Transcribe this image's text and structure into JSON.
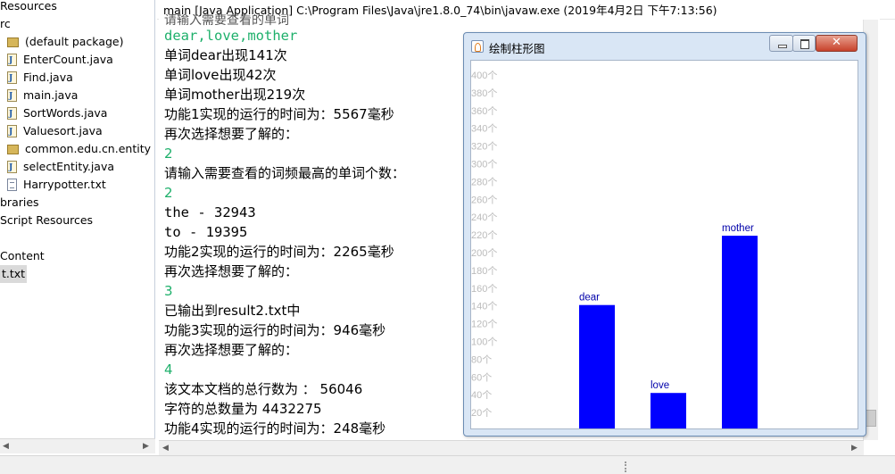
{
  "explorer": {
    "items": [
      {
        "label": "Resources",
        "icon": "none"
      },
      {
        "label": "rc",
        "icon": "none"
      },
      {
        "label": "(default package)",
        "icon": "package-icon"
      },
      {
        "label": "EnterCount.java",
        "icon": "java-file-icon"
      },
      {
        "label": "Find.java",
        "icon": "java-file-icon"
      },
      {
        "label": "main.java",
        "icon": "java-file-icon"
      },
      {
        "label": "SortWords.java",
        "icon": "java-file-icon"
      },
      {
        "label": "Valuesort.java",
        "icon": "java-file-icon"
      },
      {
        "label": "common.edu.cn.entity",
        "icon": "package-icon"
      },
      {
        "label": "selectEntity.java",
        "icon": "java-file-icon"
      },
      {
        "label": "Harrypotter.txt",
        "icon": "text-file-icon"
      },
      {
        "label": "braries",
        "icon": "none"
      },
      {
        "label": "Script Resources",
        "icon": "none"
      },
      {
        "label": "",
        "icon": "none"
      },
      {
        "label": "Content",
        "icon": "none"
      },
      {
        "label": "t.txt",
        "icon": "none",
        "selected": true
      }
    ]
  },
  "console": {
    "header": "main [Java Application] C:\\Program Files\\Java\\jre1.8.0_74\\bin\\javaw.exe (2019年4月2日 下午7:13:56)",
    "cut_line": "请输入需要查看的单词",
    "lines": [
      {
        "text": "dear,love,mother",
        "kind": "in mono"
      },
      {
        "text": "单词dear出现141次",
        "kind": "out"
      },
      {
        "text": "单词love出现42次",
        "kind": "out"
      },
      {
        "text": "单词mother出现219次",
        "kind": "out"
      },
      {
        "text": "功能1实现的运行的时间为：5567毫秒",
        "kind": "out"
      },
      {
        "text": "再次选择想要了解的：",
        "kind": "out"
      },
      {
        "text": "2",
        "kind": "in"
      },
      {
        "text": "请输入需要查看的词频最高的单词个数：",
        "kind": "out"
      },
      {
        "text": "2",
        "kind": "in"
      },
      {
        "text": "the - 32943",
        "kind": "out mono"
      },
      {
        "text": "to - 19395",
        "kind": "out mono"
      },
      {
        "text": "功能2实现的运行的时间为：2265毫秒",
        "kind": "out"
      },
      {
        "text": "再次选择想要了解的：",
        "kind": "out"
      },
      {
        "text": "3",
        "kind": "in"
      },
      {
        "text": "已输出到result2.txt中",
        "kind": "out"
      },
      {
        "text": "功能3实现的运行的时间为：946毫秒",
        "kind": "out"
      },
      {
        "text": "再次选择想要了解的：",
        "kind": "out"
      },
      {
        "text": "4",
        "kind": "in"
      },
      {
        "text": "该文本文档的总行数为 ： 56046",
        "kind": "out"
      },
      {
        "text": "字符的总数量为 4432275",
        "kind": "out"
      },
      {
        "text": "功能4实现的运行的时间为：248毫秒",
        "kind": "out"
      }
    ]
  },
  "window": {
    "title": "绘制柱形图",
    "icon": "java-cup-icon"
  },
  "chart_data": {
    "type": "bar",
    "categories": [
      "dear",
      "love",
      "mother"
    ],
    "values": [
      141,
      42,
      219
    ],
    "title": "",
    "xlabel": "",
    "ylabel": "",
    "ylim": [
      0,
      400
    ],
    "y_ticks": [
      "20个",
      "40个",
      "60个",
      "80个",
      "100个",
      "120个",
      "140个",
      "160个",
      "180个",
      "200个",
      "220个",
      "240个",
      "260个",
      "280个",
      "300个",
      "320个",
      "340个",
      "360个",
      "380个",
      "400个"
    ],
    "y_tick_values": [
      20,
      40,
      60,
      80,
      100,
      120,
      140,
      160,
      180,
      200,
      220,
      240,
      260,
      280,
      300,
      320,
      340,
      360,
      380,
      400
    ],
    "bar_color": "#0000ff",
    "label_color": "#0000aa",
    "tick_color": "#bbbbbb",
    "grid": false
  }
}
